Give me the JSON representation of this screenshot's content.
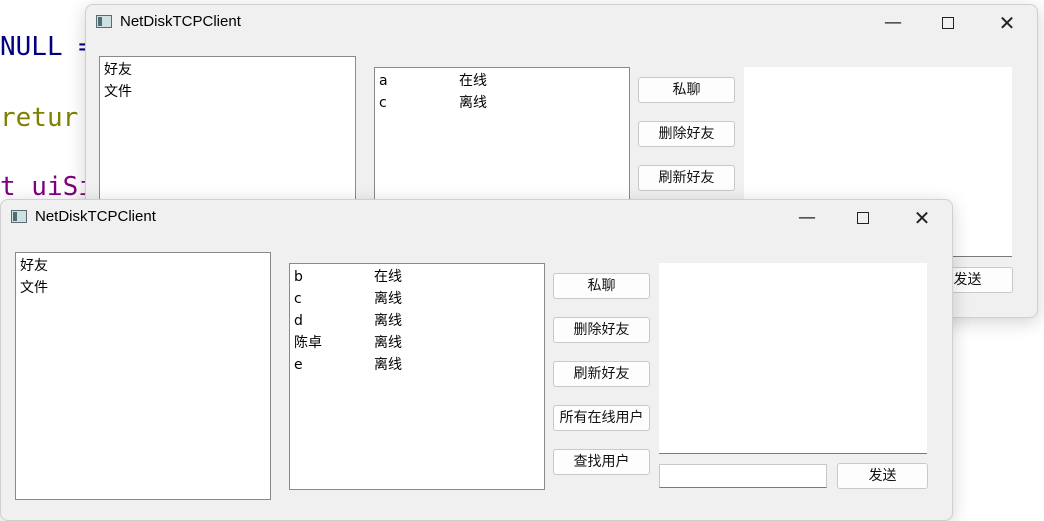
{
  "code_lines": [
    {
      "text": "NULL =",
      "cls": "kw-navy"
    },
    {
      "text": " retur",
      "cls": "kw-olive"
    },
    {
      "text": "t uiSi",
      "cls": "kw-purple"
    }
  ],
  "back_window": {
    "title": "NetDiskTCPClient",
    "nav": [
      "好友",
      "文件"
    ],
    "friends": [
      {
        "name": "a",
        "status": "在线"
      },
      {
        "name": "c",
        "status": "离线"
      }
    ],
    "buttons": {
      "private_chat": "私聊",
      "delete_friend": "删除好友",
      "refresh_friend": "刷新好友"
    },
    "send": "发送"
  },
  "front_window": {
    "title": "NetDiskTCPClient",
    "nav": [
      "好友",
      "文件"
    ],
    "friends": [
      {
        "name": "b",
        "status": "在线"
      },
      {
        "name": "c",
        "status": "离线"
      },
      {
        "name": "d",
        "status": "离线"
      },
      {
        "name": "陈卓",
        "status": "离线"
      },
      {
        "name": "e",
        "status": "离线"
      }
    ],
    "buttons": {
      "private_chat": "私聊",
      "delete_friend": "删除好友",
      "refresh_friend": "刷新好友",
      "all_online": "所有在线用户",
      "find_user": "查找用户"
    },
    "message_input": {
      "value": "",
      "placeholder": ""
    },
    "send": "发送"
  }
}
